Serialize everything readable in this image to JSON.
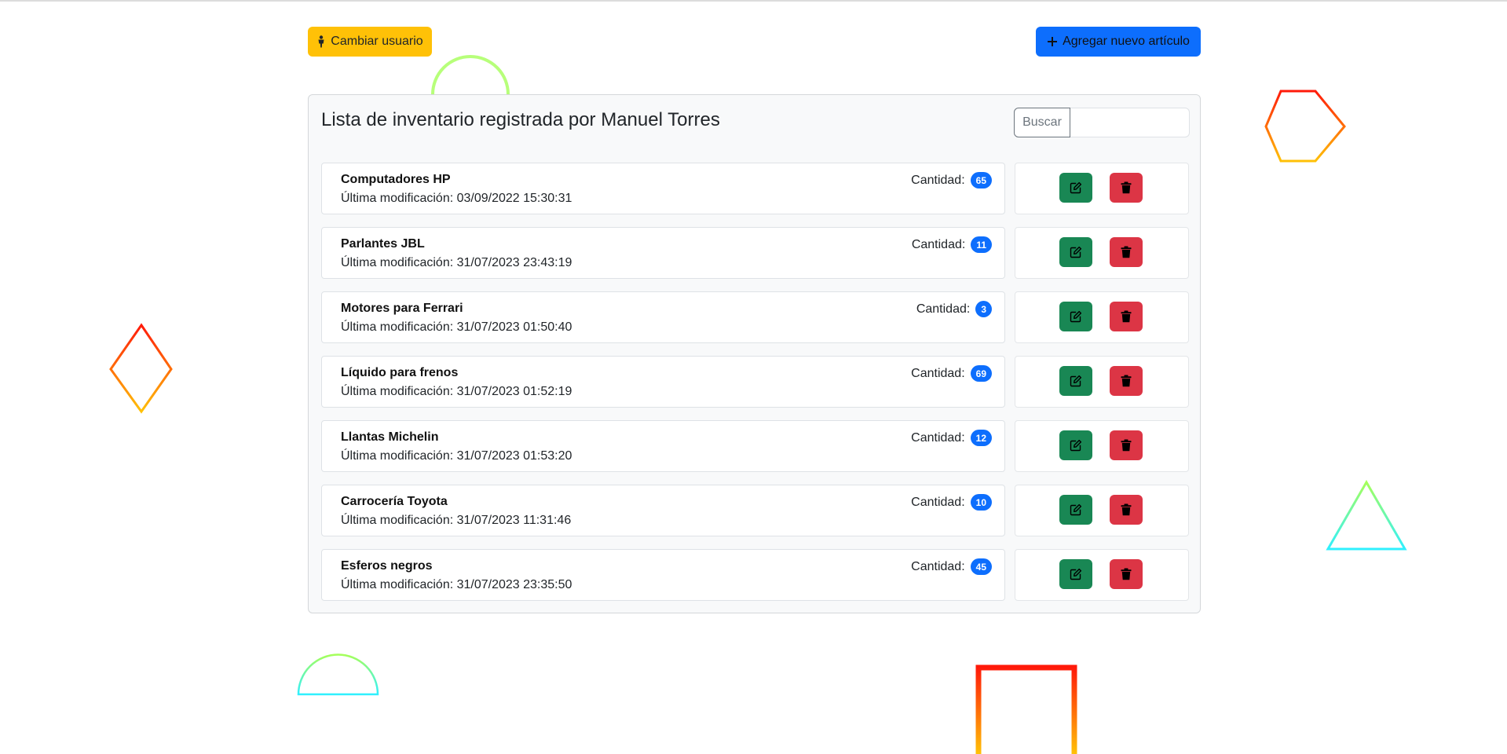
{
  "toolbar": {
    "change_user_label": "Cambiar usuario",
    "add_item_label": "Agregar nuevo artículo"
  },
  "panel": {
    "title": "Lista de inventario registrada por Manuel Torres",
    "search": {
      "label": "Buscar",
      "value": "",
      "placeholder": ""
    }
  },
  "items": [
    {
      "name": "Computadores HP",
      "modified": "Última modificación: 03/09/2022 15:30:31",
      "quantity_label": "Cantidad:",
      "quantity": "65"
    },
    {
      "name": "Parlantes JBL",
      "modified": "Última modificación: 31/07/2023 23:43:19",
      "quantity_label": "Cantidad:",
      "quantity": "11"
    },
    {
      "name": "Motores para Ferrari",
      "modified": "Última modificación: 31/07/2023 01:50:40",
      "quantity_label": "Cantidad:",
      "quantity": "3"
    },
    {
      "name": "Líquido para frenos",
      "modified": "Última modificación: 31/07/2023 01:52:19",
      "quantity_label": "Cantidad:",
      "quantity": "69"
    },
    {
      "name": "Llantas Michelin",
      "modified": "Última modificación: 31/07/2023 01:53:20",
      "quantity_label": "Cantidad:",
      "quantity": "12"
    },
    {
      "name": "Carrocería Toyota",
      "modified": "Última modificación: 31/07/2023 11:31:46",
      "quantity_label": "Cantidad:",
      "quantity": "10"
    },
    {
      "name": "Esferos negros",
      "modified": "Última modificación: 31/07/2023 23:35:50",
      "quantity_label": "Cantidad:",
      "quantity": "45"
    }
  ],
  "icons": {
    "change_user": "person-standing-icon",
    "add_item": "plus-icon",
    "edit": "pencil-square-icon",
    "delete": "trash-icon"
  },
  "colors": {
    "warning": "#ffc107",
    "primary": "#0d6efd",
    "success": "#198754",
    "danger": "#dc3545"
  }
}
